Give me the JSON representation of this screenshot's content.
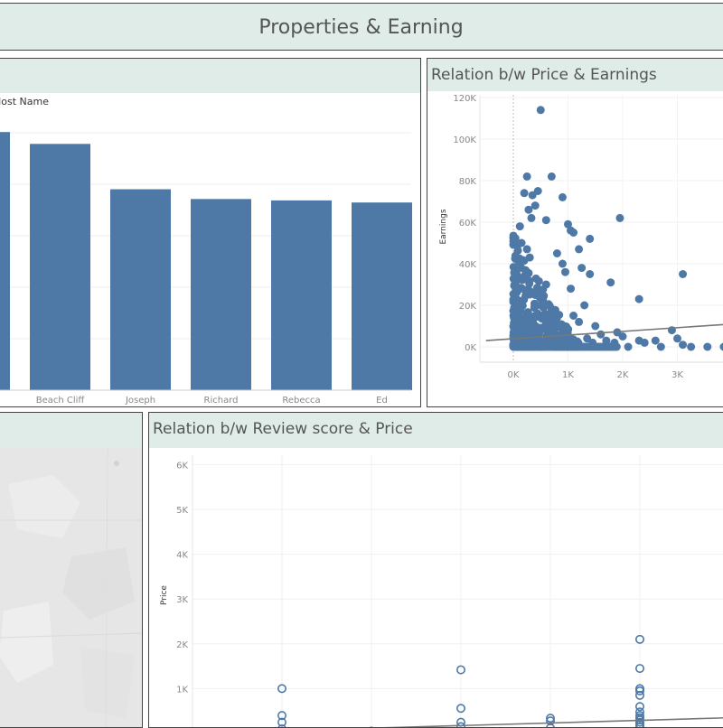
{
  "dashboard": {
    "title": "Properties & Earning"
  },
  "top_hosts_panel": {
    "title": "",
    "column_header": "Host Name",
    "chart_data": {
      "type": "bar",
      "categories": [
        "",
        "Beach Cliff",
        "Joseph",
        "Richard",
        "Rebecca",
        "Ed"
      ],
      "values": [
        370,
        353,
        288,
        274,
        272,
        269
      ],
      "ylim": [
        0,
        400
      ],
      "xlabel": "Host Name",
      "ylabel": "",
      "color": "#4e79a7"
    }
  },
  "price_earnings_panel": {
    "title": "Relation b/w Price & Earnings",
    "chart_data": {
      "type": "scatter",
      "title": "Relation b/w Price & Earnings",
      "xlabel": "",
      "ylabel": "Earnings",
      "x_ticks": [
        "0K",
        "1K",
        "2K",
        "3K"
      ],
      "y_ticks": [
        "0K",
        "20K",
        "40K",
        "60K",
        "80K",
        "100K",
        "120K"
      ],
      "xlim": [
        -500,
        3850
      ],
      "ylim": [
        -4000,
        122000
      ],
      "points": [
        [
          500,
          114000
        ],
        [
          250,
          82000
        ],
        [
          700,
          82000
        ],
        [
          200,
          74000
        ],
        [
          350,
          73000
        ],
        [
          450,
          75000
        ],
        [
          900,
          72000
        ],
        [
          400,
          68000
        ],
        [
          280,
          66000
        ],
        [
          330,
          62000
        ],
        [
          1000,
          59000
        ],
        [
          120,
          58000
        ],
        [
          600,
          61000
        ],
        [
          1950,
          62000
        ],
        [
          1050,
          56000
        ],
        [
          1100,
          55000
        ],
        [
          1400,
          52000
        ],
        [
          150,
          50000
        ],
        [
          250,
          47000
        ],
        [
          800,
          45000
        ],
        [
          1200,
          47000
        ],
        [
          300,
          43000
        ],
        [
          900,
          40000
        ],
        [
          100,
          41000
        ],
        [
          1250,
          38000
        ],
        [
          1400,
          35000
        ],
        [
          3100,
          35000
        ],
        [
          950,
          36000
        ],
        [
          1780,
          31000
        ],
        [
          600,
          30000
        ],
        [
          1050,
          28000
        ],
        [
          2300,
          23000
        ],
        [
          400,
          25000
        ],
        [
          1300,
          20000
        ],
        [
          1900,
          7000
        ],
        [
          2000,
          5000
        ],
        [
          2300,
          3000
        ],
        [
          2400,
          2000
        ],
        [
          2600,
          3000
        ],
        [
          2900,
          8000
        ],
        [
          3000,
          4000
        ],
        [
          3100,
          1000
        ],
        [
          3250,
          0
        ],
        [
          3550,
          0
        ],
        [
          3850,
          0
        ],
        [
          2700,
          0
        ],
        [
          2100,
          0
        ],
        [
          1500,
          10000
        ],
        [
          1600,
          6000
        ],
        [
          1700,
          3000
        ],
        [
          1200,
          12000
        ],
        [
          1100,
          15000
        ],
        [
          700,
          18000
        ],
        [
          500,
          20000
        ],
        [
          800,
          14000
        ],
        [
          650,
          10000
        ],
        [
          900,
          7000
        ],
        [
          1000,
          5000
        ],
        [
          1350,
          4000
        ],
        [
          1450,
          2000
        ],
        [
          1700,
          1000
        ],
        [
          1850,
          2000
        ]
      ],
      "dense_cluster": {
        "x_range": [
          0,
          1200
        ],
        "y_range": [
          0,
          55000
        ]
      },
      "trend_line": [
        [
          -500,
          3000
        ],
        [
          4000,
          11000
        ]
      ]
    }
  },
  "map_panel": {
    "title": ""
  },
  "review_price_panel": {
    "title": "Relation b/w Review score & Price",
    "chart_data": {
      "type": "scatter",
      "title": "Relation b/w Review score & Price",
      "xlabel": "",
      "ylabel": "Price",
      "y_ticks": [
        "1K",
        "2K",
        "3K",
        "4K",
        "5K",
        "6K"
      ],
      "ylim": [
        0,
        6000
      ],
      "x_categories": 6,
      "points": [
        [
          1,
          1000
        ],
        [
          1,
          400
        ],
        [
          1,
          250
        ],
        [
          1,
          100
        ],
        [
          2,
          50
        ],
        [
          3,
          1420
        ],
        [
          3,
          560
        ],
        [
          3,
          250
        ],
        [
          3,
          150
        ],
        [
          4,
          340
        ],
        [
          4,
          280
        ],
        [
          4,
          120
        ],
        [
          5,
          2100
        ],
        [
          5,
          1450
        ],
        [
          5,
          1000
        ],
        [
          5,
          950
        ],
        [
          5,
          850
        ],
        [
          5,
          600
        ],
        [
          5,
          480
        ],
        [
          5,
          400
        ],
        [
          5,
          350
        ],
        [
          5,
          300
        ],
        [
          5,
          250
        ],
        [
          5,
          200
        ],
        [
          5,
          150
        ]
      ],
      "trend_line": [
        [
          0,
          0
        ],
        [
          6,
          350
        ]
      ]
    }
  }
}
